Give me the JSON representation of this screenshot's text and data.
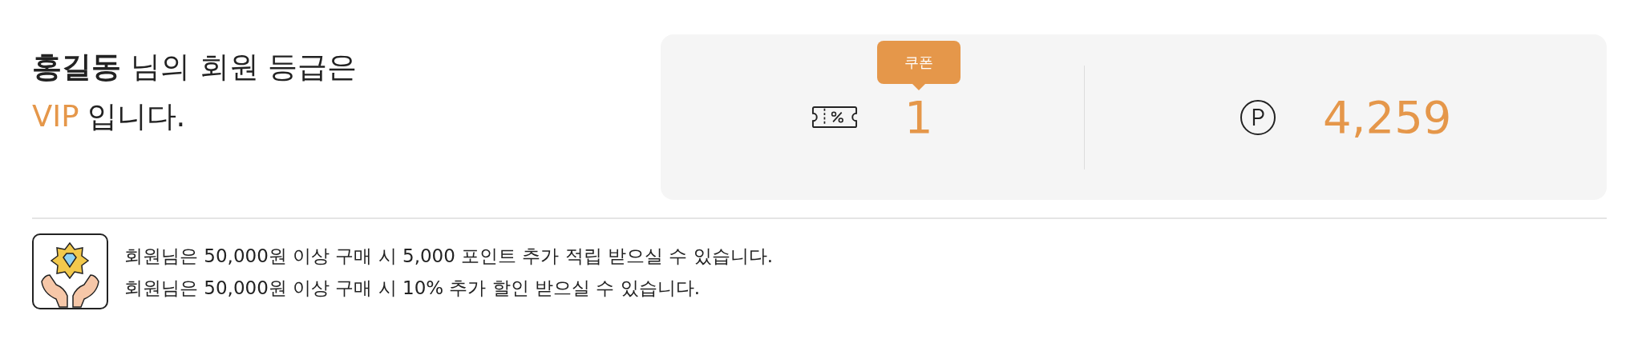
{
  "greeting": {
    "line": "**홍길동** 님의 회원 등급은",
    "grade": "VIP",
    "suffix": "입니다."
  },
  "summary": {
    "coupon": {
      "badge": "쿠폰",
      "count": "1"
    },
    "points": {
      "amount": "4,259"
    }
  },
  "benefits": [
    "회원님은 50,000원 이상 구매 시 5,000 포인트 추가 적립 받으실 수 있습니다.",
    "회원님은 50,000원 이상 구매 시 10% 추가 할인 받으실 수 있습니다."
  ]
}
